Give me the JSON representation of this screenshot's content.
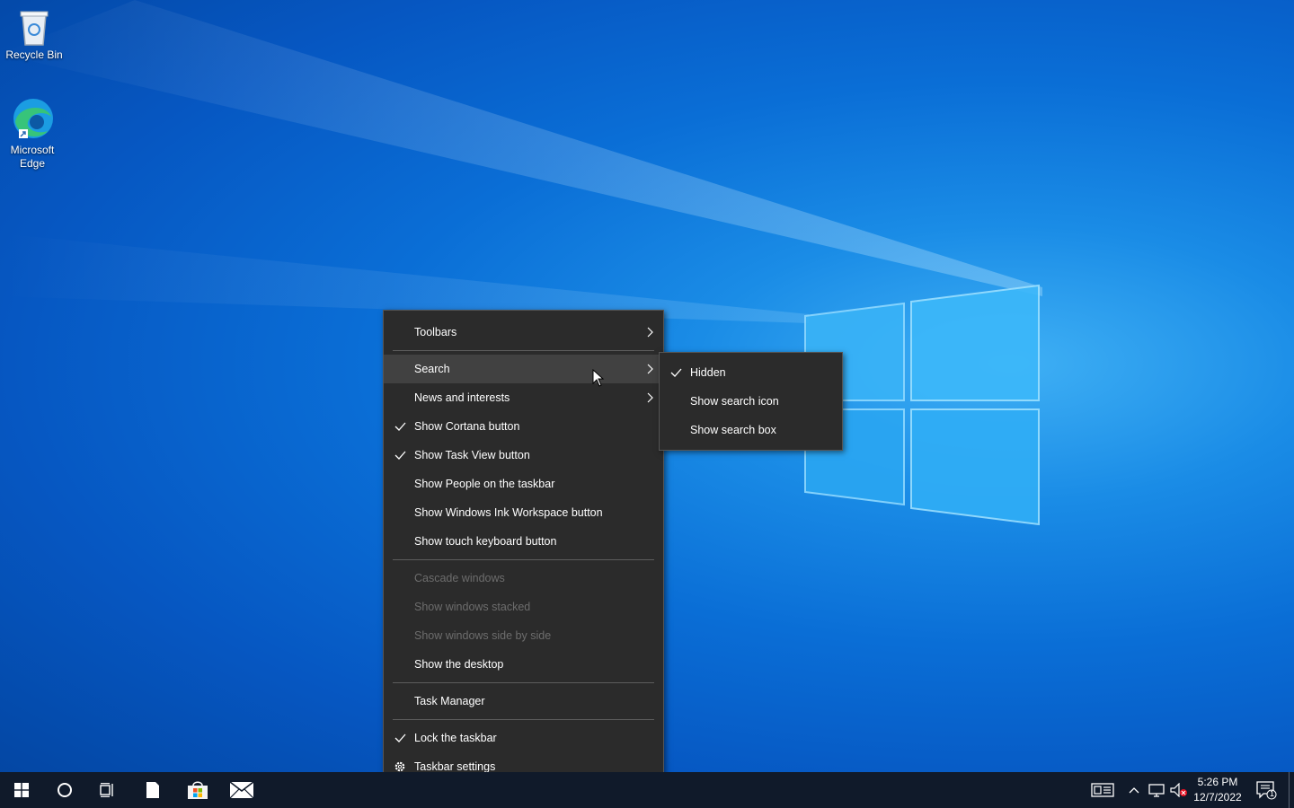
{
  "desktop": {
    "icons": [
      {
        "label": "Recycle Bin",
        "icon": "recycle-bin-icon"
      },
      {
        "label": "Microsoft Edge",
        "icon": "edge-icon"
      }
    ]
  },
  "context_menu": {
    "items": [
      {
        "label": "Toolbars",
        "submenu": true
      },
      {
        "label": "Search",
        "submenu": true,
        "hovered": true
      },
      {
        "label": "News and interests",
        "submenu": true
      },
      {
        "label": "Show Cortana button",
        "checked": true
      },
      {
        "label": "Show Task View button",
        "checked": true
      },
      {
        "label": "Show People on the taskbar"
      },
      {
        "label": "Show Windows Ink Workspace button"
      },
      {
        "label": "Show touch keyboard button"
      },
      {
        "label": "Cascade windows",
        "disabled": true
      },
      {
        "label": "Show windows stacked",
        "disabled": true
      },
      {
        "label": "Show windows side by side",
        "disabled": true
      },
      {
        "label": "Show the desktop"
      },
      {
        "label": "Task Manager"
      },
      {
        "label": "Lock the taskbar",
        "checked": true
      },
      {
        "label": "Taskbar settings",
        "icon": "gear-icon"
      }
    ]
  },
  "search_submenu": {
    "items": [
      {
        "label": "Hidden",
        "checked": true
      },
      {
        "label": "Show search icon"
      },
      {
        "label": "Show search box"
      }
    ]
  },
  "taskbar": {
    "buttons": [
      "windows-start-icon",
      "cortana-circle-icon",
      "task-view-icon",
      "file-icon",
      "store-icon",
      "mail-icon"
    ],
    "tray": {
      "time": "5:26 PM",
      "date": "12/7/2022",
      "notification_count": "1"
    }
  },
  "colors": {
    "menu_bg": "#2b2b2b",
    "menu_hover": "#414141",
    "taskbar_bg": "#101a2a",
    "accent": "#0a6ed6"
  }
}
